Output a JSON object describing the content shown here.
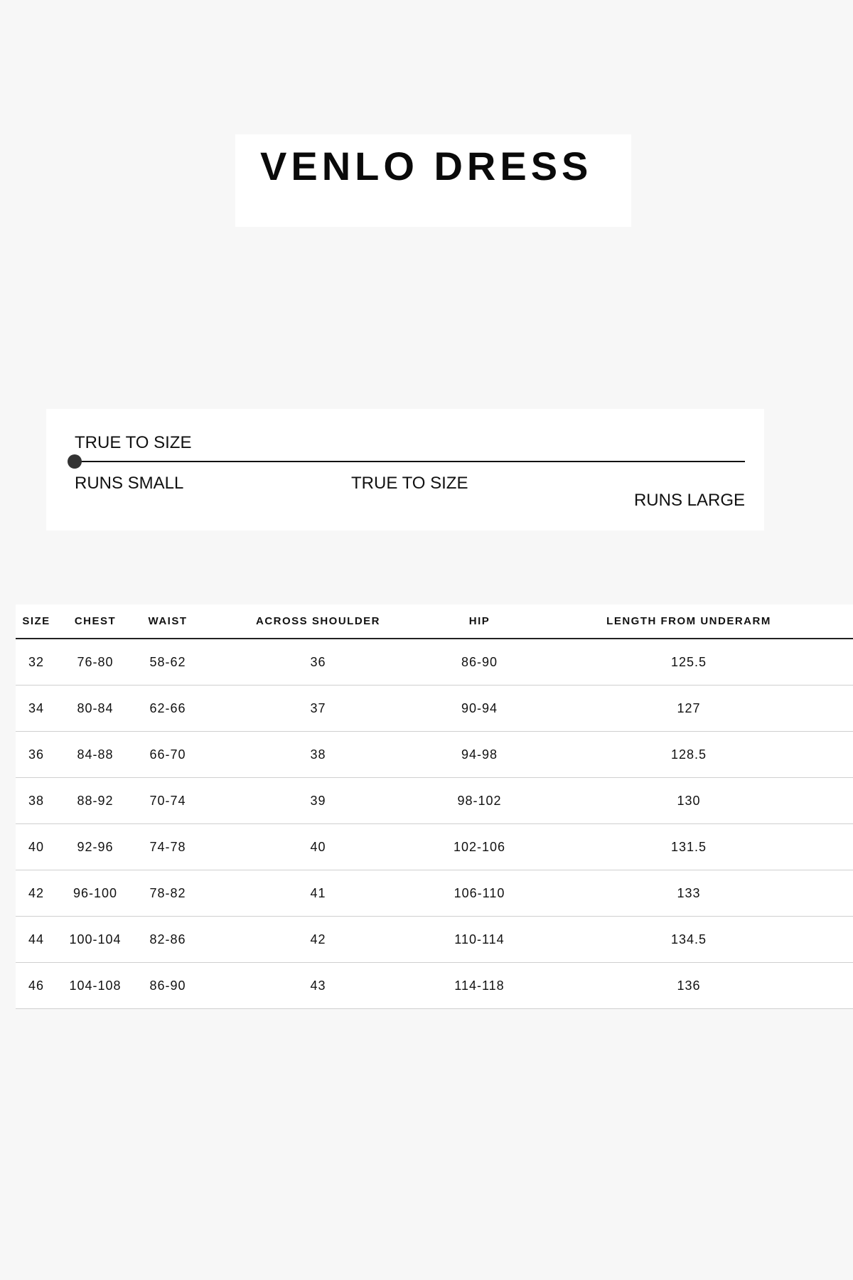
{
  "title": "VENLO DRESS",
  "fit": {
    "current_label": "TRUE TO SIZE",
    "marker_position": 0,
    "scale_labels": {
      "small": "RUNS SMALL",
      "true": "TRUE TO SIZE",
      "large": "RUNS LARGE"
    }
  },
  "size_table": {
    "headers": [
      "SIZE",
      "CHEST",
      "WAIST",
      "ACROSS SHOULDER",
      "HIP",
      "LENGTH FROM UNDERARM"
    ],
    "rows": [
      [
        "32",
        "76-80",
        "58-62",
        "36",
        "86-90",
        "125.5"
      ],
      [
        "34",
        "80-84",
        "62-66",
        "37",
        "90-94",
        "127"
      ],
      [
        "36",
        "84-88",
        "66-70",
        "38",
        "94-98",
        "128.5"
      ],
      [
        "38",
        "88-92",
        "70-74",
        "39",
        "98-102",
        "130"
      ],
      [
        "40",
        "92-96",
        "74-78",
        "40",
        "102-106",
        "131.5"
      ],
      [
        "42",
        "96-100",
        "78-82",
        "41",
        "106-110",
        "133"
      ],
      [
        "44",
        "100-104",
        "82-86",
        "42",
        "110-114",
        "134.5"
      ],
      [
        "46",
        "104-108",
        "86-90",
        "43",
        "114-118",
        "136"
      ]
    ]
  },
  "colors": {
    "page_background": "#f7f7f7",
    "card_background": "#ffffff",
    "text": "#111111",
    "marker": "#333333",
    "row_divider": "#cfcfcf"
  }
}
